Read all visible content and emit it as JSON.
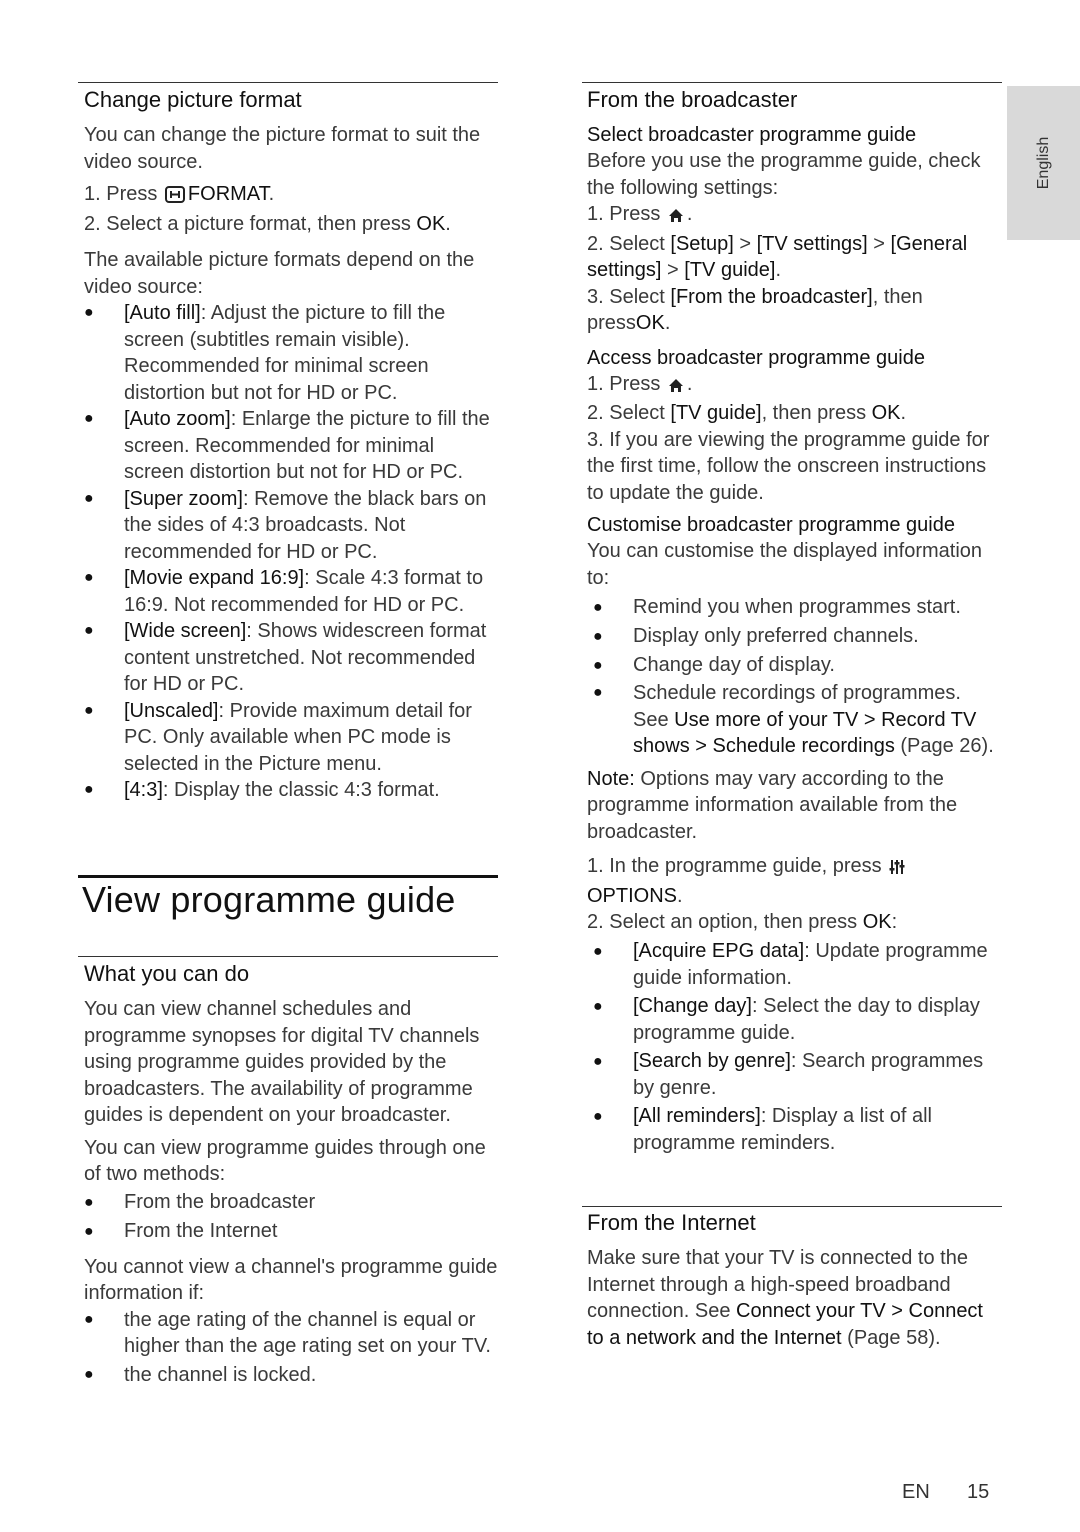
{
  "side_tab": {
    "label": "English"
  },
  "footer": {
    "lang": "EN",
    "page": "15"
  },
  "left": {
    "change_picture_format": {
      "heading": "Change picture format",
      "intro": "You can change the picture format to suit the video source.",
      "step1_prefix": "1. Press ",
      "step1_icon": "format-icon",
      "step1_key": "FORMAT",
      "step1_suffix": ".",
      "step2_prefix": "2. Select a picture format, then press ",
      "step2_key": "OK",
      "step2_suffix": ".",
      "available": "The available picture formats depend on the video source:",
      "formats": [
        {
          "term": "[Auto fill]",
          "desc": ": Adjust the picture to fill the screen (subtitles remain visible). Recommended for minimal screen distortion but not for HD or PC."
        },
        {
          "term": "[Auto zoom]",
          "desc": ": Enlarge the picture to fill the screen. Recommended for minimal screen distortion but not for HD or PC."
        },
        {
          "term": "[Super zoom]",
          "desc": ": Remove the black bars on the sides of 4:3 broadcasts. Not recommended for HD or PC."
        },
        {
          "term": "[Movie expand 16:9]",
          "desc": ": Scale 4:3 format to 16:9. Not recommended for HD or PC."
        },
        {
          "term": "[Wide screen]",
          "desc": ": Shows widescreen format content unstretched. Not recommended for HD or PC."
        },
        {
          "term": "[Unscaled]",
          "desc": ": Provide maximum detail for PC. Only available when PC mode is selected in the Picture menu."
        },
        {
          "term": "[4:3]",
          "desc": ": Display the classic 4:3 format."
        }
      ]
    },
    "view_programme_guide": {
      "title": "View programme guide"
    },
    "what_you_can_do": {
      "heading": "What you can do",
      "para1": "You can view channel schedules and programme synopses for digital TV channels using programme guides provided by the broadcasters. The availability of programme guides is dependent on your broadcaster.",
      "para2": "You can view programme guides through one of two methods:",
      "methods": [
        "From the broadcaster",
        "From the Internet"
      ],
      "para3": "You cannot view a channel's programme guide information if:",
      "conditions": [
        "the age rating of the channel is equal or higher than the age rating set on your TV.",
        "the channel is locked."
      ]
    }
  },
  "right": {
    "from_broadcaster": {
      "heading": "From the broadcaster",
      "select": {
        "heading": "Select broadcaster programme guide",
        "intro": "Before you use the programme guide, check the following settings:",
        "step1_prefix": "1. Press ",
        "step1_icon": "home-icon",
        "step1_suffix": ".",
        "step2_prefix": "2. Select ",
        "step2_path": [
          "[Setup]",
          "[TV settings]",
          "[General settings]",
          "[TV guide]"
        ],
        "step2_sep": " > ",
        "step2_suffix": ".",
        "step3_prefix": "3. Select ",
        "step3_term": "[From the broadcaster]",
        "step3_mid": ", then press",
        "step3_key": "OK",
        "step3_suffix": "."
      },
      "access": {
        "heading": "Access broadcaster programme guide",
        "step1_prefix": "1. Press ",
        "step1_icon": "home-icon",
        "step1_suffix": ".",
        "step2_prefix": "2. Select ",
        "step2_term": "[TV guide]",
        "step2_mid": ", then press ",
        "step2_key": "OK",
        "step2_suffix": ".",
        "step3": "3. If you are viewing the programme guide for the first time, follow the onscreen instructions to update the guide."
      },
      "customise": {
        "heading": "Customise broadcaster programme guide",
        "intro": "You can customise the displayed information to:",
        "items": [
          "Remind you when programmes start.",
          "Display only preferred channels.",
          "Change day of display."
        ],
        "schedule_item": {
          "text": "Schedule recordings of programmes. See ",
          "link": "Use more of your TV > Record TV shows > Schedule recordings",
          "page": " (Page 26)."
        },
        "note_label": "Note:",
        "note_text": " Options may vary according to the programme information available from the broadcaster.",
        "step1_prefix": "1. In the programme guide, press ",
        "step1_icon": "options-icon",
        "step1_key": "OPTIONS",
        "step1_suffix": ".",
        "step2_prefix": "2. Select an option, then press ",
        "step2_key": "OK",
        "step2_suffix": ":",
        "options": [
          {
            "term": "[Acquire EPG data]",
            "desc": ": Update programme guide information."
          },
          {
            "term": "[Change day]",
            "desc": ": Select the day to display programme guide."
          },
          {
            "term": "[Search by genre]",
            "desc": ": Search programmes by genre."
          },
          {
            "term": "[All reminders]",
            "desc": ": Display a list of all programme reminders."
          }
        ]
      }
    },
    "from_internet": {
      "heading": "From the Internet",
      "text": "Make sure that your TV is connected to the Internet through a high-speed broadband connection. See ",
      "link": "Connect your TV > Connect to a network and the Internet",
      "page": " (Page 58)."
    }
  }
}
